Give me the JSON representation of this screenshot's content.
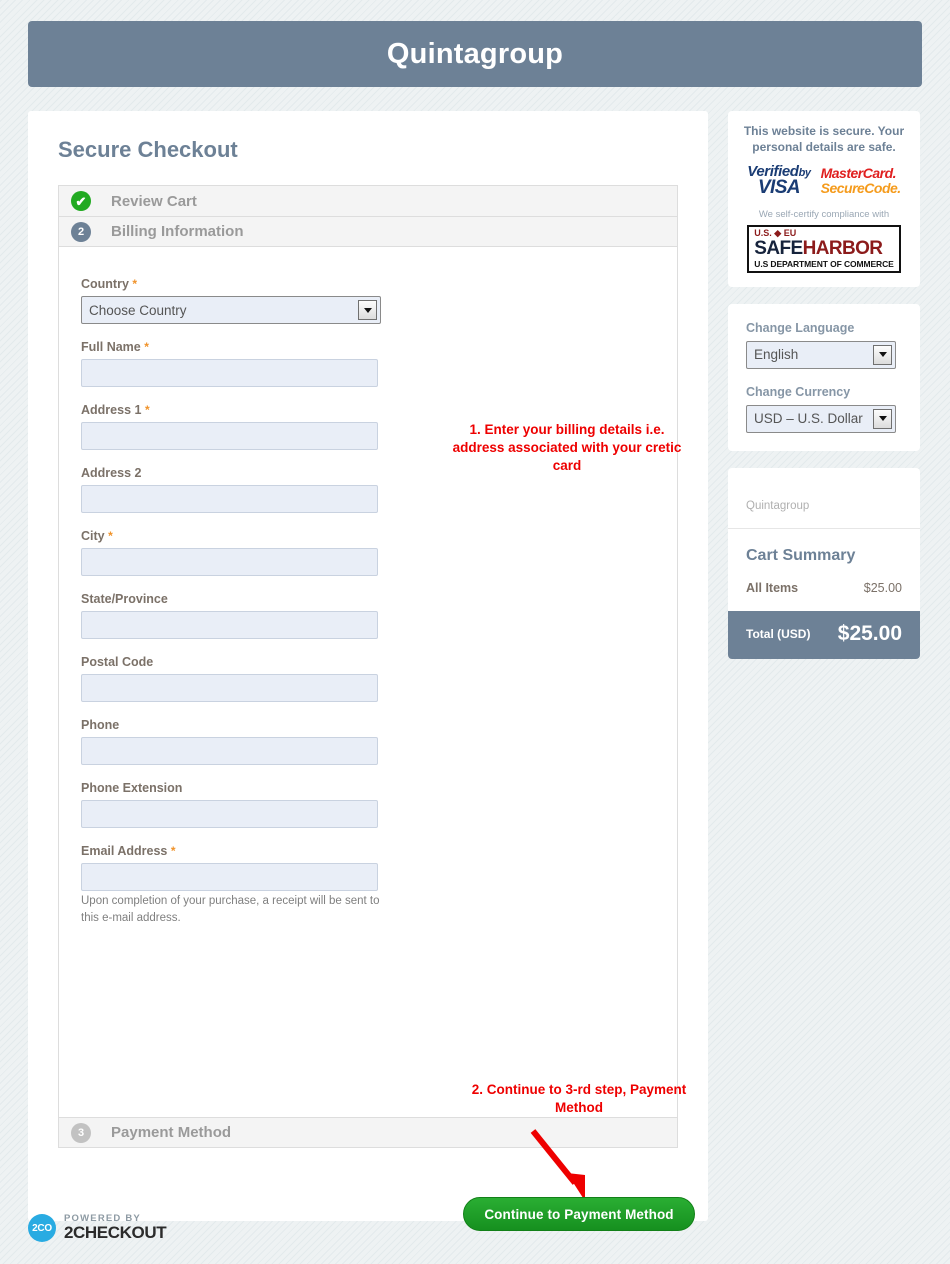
{
  "header": {
    "title": "Quintagroup"
  },
  "main": {
    "page_title": "Secure Checkout",
    "steps": [
      {
        "number": "1",
        "label": "Review Cart",
        "state": "done",
        "badge_glyph": "✔"
      },
      {
        "number": "2",
        "label": "Billing Information",
        "state": "active"
      },
      {
        "number": "3",
        "label": "Payment Method",
        "state": "idle"
      }
    ],
    "form": {
      "country": {
        "label": "Country",
        "required": "*",
        "value": "Choose Country",
        "arrow_icon": "chevron-down-icon"
      },
      "fields": [
        {
          "label": "Full Name",
          "required": "*",
          "value": "",
          "placeholder": ""
        },
        {
          "label": "Address 1",
          "required": "*",
          "value": "",
          "placeholder": ""
        },
        {
          "label": "Address 2",
          "required": "",
          "value": "",
          "placeholder": ""
        },
        {
          "label": "City",
          "required": "*",
          "value": "",
          "placeholder": ""
        },
        {
          "label": "State/Province",
          "required": "",
          "value": "",
          "placeholder": ""
        },
        {
          "label": "Postal Code",
          "required": "",
          "value": "",
          "placeholder": ""
        },
        {
          "label": "Phone",
          "required": "",
          "value": "",
          "placeholder": ""
        },
        {
          "label": "Phone Extension",
          "required": "",
          "value": "",
          "placeholder": ""
        },
        {
          "label": "Email Address",
          "required": "*",
          "value": "",
          "placeholder": ""
        }
      ],
      "email_help": "Upon completion of your purchase, a receipt will be sent to this e-mail address.",
      "continue_label": "Continue to Payment Method"
    },
    "annotations": [
      {
        "text": "1. Enter your billing details i.e. address associated with your cretic card",
        "color": "#ee0000"
      },
      {
        "text": "2. Continue to 3-rd step, Payment Method",
        "color": "#ee0000"
      }
    ]
  },
  "sidebar": {
    "secure": {
      "text": "This website is secure. Your personal details are safe.",
      "visa": {
        "verified": "Verified",
        "by": "by",
        "brand": "VISA"
      },
      "mastercard": {
        "line1": "MasterCard.",
        "line2": "SecureCode."
      },
      "selfcertify": "We self-certify compliance with",
      "safeharbor": {
        "top": "U.S. ◆ EU",
        "safe": "SAFE",
        "harbor": "HARBOR",
        "bottom": "U.S DEPARTMENT OF COMMERCE"
      }
    },
    "language": {
      "language_label": "Change Language",
      "language_value": "English",
      "currency_label": "Change Currency",
      "currency_value": "USD – U.S. Dollar"
    },
    "cart": {
      "brand": "Quintagroup",
      "title": "Cart Summary",
      "items": [
        {
          "name": "All Items",
          "price": "$25.00"
        }
      ],
      "total_label": "Total (USD)",
      "total_value": "$25.00"
    }
  },
  "footer": {
    "logo_mark": "2CO",
    "powered_by": "POWERED BY",
    "brand": "2CHECKOUT"
  },
  "colors": {
    "brand_slate": "#6d8196",
    "success_green": "#22aa22",
    "button_green": "#1e9d28",
    "annotation_red": "#ee0000",
    "required_orange": "#f0932b"
  }
}
